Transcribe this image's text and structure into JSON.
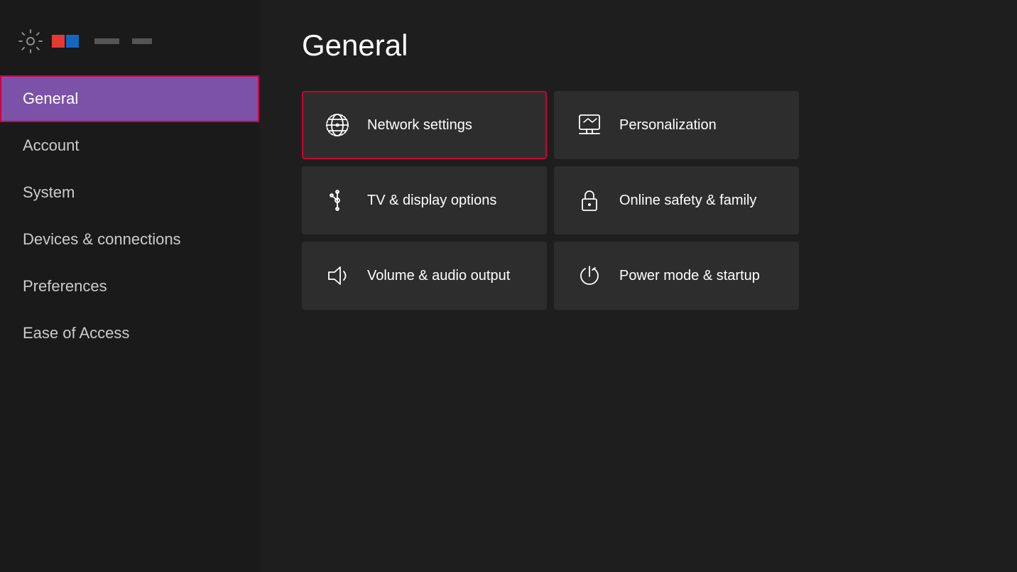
{
  "sidebar": {
    "items": [
      {
        "id": "general",
        "label": "General",
        "active": true
      },
      {
        "id": "account",
        "label": "Account",
        "active": false
      },
      {
        "id": "system",
        "label": "System",
        "active": false
      },
      {
        "id": "devices",
        "label": "Devices & connections",
        "active": false
      },
      {
        "id": "preferences",
        "label": "Preferences",
        "active": false
      },
      {
        "id": "ease",
        "label": "Ease of Access",
        "active": false
      }
    ]
  },
  "main": {
    "title": "General",
    "tiles": [
      {
        "id": "network",
        "label": "Network settings",
        "icon": "network",
        "highlighted": true
      },
      {
        "id": "personalization",
        "label": "Personalization",
        "icon": "personalization",
        "highlighted": false
      },
      {
        "id": "tv-display",
        "label": "TV & display options",
        "icon": "tv-display",
        "highlighted": false
      },
      {
        "id": "online-safety",
        "label": "Online safety & family",
        "icon": "lock",
        "highlighted": false
      },
      {
        "id": "volume",
        "label": "Volume & audio output",
        "icon": "volume",
        "highlighted": false
      },
      {
        "id": "power",
        "label": "Power mode & startup",
        "icon": "power",
        "highlighted": false
      }
    ]
  }
}
